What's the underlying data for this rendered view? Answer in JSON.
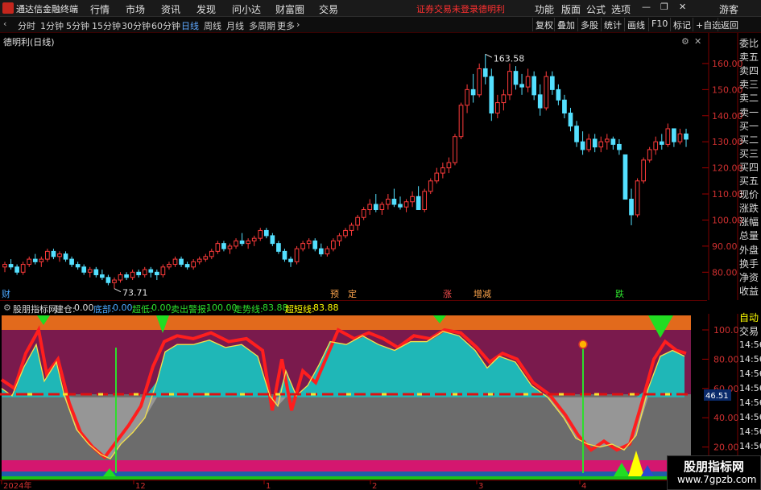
{
  "titlebar": {
    "app_title": "通达信金融终端",
    "menus": [
      "行情",
      "市场",
      "资讯",
      "发现",
      "问小达",
      "财富圈",
      "交易"
    ],
    "notice": "证券交易未登录",
    "stock": "德明利",
    "right_menus": [
      "功能",
      "版面",
      "公式",
      "选项"
    ],
    "guest": "游客"
  },
  "toolbar": {
    "periods": [
      "分时",
      "1分钟",
      "5分钟",
      "15分钟",
      "30分钟",
      "60分钟",
      "日线",
      "周线",
      "月线",
      "多周期",
      "更多"
    ],
    "active_period": "日线",
    "right_buttons": [
      "复权",
      "叠加",
      "多股",
      "统计",
      "画线",
      "F10",
      "标记",
      "+自选",
      "返回"
    ]
  },
  "main": {
    "stock_label": "德明利(日线)",
    "high_label": "163.58",
    "low_label": "73.71",
    "y_ticks": [
      "160.00",
      "150.00",
      "140.00",
      "130.00",
      "120.00",
      "110.00",
      "100.00",
      "90.00",
      "80.00"
    ],
    "x_ticks": [
      "2024年",
      "12",
      "1",
      "2",
      "3",
      "4"
    ],
    "event_tags": [
      "财",
      "预",
      "定",
      "涨",
      "增减",
      "跌"
    ]
  },
  "indicator": {
    "name": "股朋指标网",
    "fields": [
      {
        "label": "建仓:",
        "value": "0.00"
      },
      {
        "label": "底部:",
        "value": "0.00"
      },
      {
        "label": "超低:",
        "value": "0.00"
      },
      {
        "label": "卖出警报:",
        "value": "100.00"
      },
      {
        "label": "走势线:",
        "value": "83.88"
      },
      {
        "label": "超短线:",
        "value": "83.88"
      }
    ],
    "y_ticks": [
      "100.0",
      "80.00",
      "60.00",
      "40.00",
      "20.00"
    ],
    "current_value": "46.51",
    "times": [
      "14:56",
      "14:56",
      "14:56",
      "14:56",
      "14:56",
      "14:56",
      "14:56",
      "14:56"
    ]
  },
  "sidebar": {
    "items": [
      "委比",
      "卖五",
      "卖四",
      "卖三",
      "卖二",
      "卖一",
      "买一",
      "买二",
      "买三",
      "买四",
      "买五",
      "现价",
      "涨跌",
      "涨幅",
      "总量",
      "外盘",
      "换手",
      "净资",
      "收益"
    ],
    "auto": "自动",
    "trade": "交易"
  },
  "watermark": {
    "name": "股朋指标网",
    "url": "www.7gpzb.com"
  },
  "chart_data": {
    "type": "candlestick",
    "title": "德明利(日线)",
    "y_range": [
      73,
      168
    ],
    "candles": [
      [
        82,
        84,
        80,
        83
      ],
      [
        83,
        85,
        81,
        82
      ],
      [
        82,
        83,
        79,
        80
      ],
      [
        80,
        84,
        79,
        83
      ],
      [
        83,
        86,
        82,
        85
      ],
      [
        85,
        87,
        83,
        84
      ],
      [
        84,
        86,
        82,
        85
      ],
      [
        85,
        89,
        84,
        88
      ],
      [
        88,
        89,
        85,
        86
      ],
      [
        86,
        88,
        84,
        87
      ],
      [
        87,
        88,
        84,
        85
      ],
      [
        85,
        86,
        82,
        83
      ],
      [
        83,
        84,
        81,
        82
      ],
      [
        82,
        83,
        79,
        80
      ],
      [
        80,
        82,
        78,
        81
      ],
      [
        81,
        82,
        78,
        79
      ],
      [
        79,
        81,
        77,
        78
      ],
      [
        78,
        79,
        75,
        76
      ],
      [
        76,
        78,
        73.71,
        77
      ],
      [
        77,
        80,
        76,
        79
      ],
      [
        79,
        80,
        77,
        78
      ],
      [
        78,
        81,
        77,
        80
      ],
      [
        80,
        81,
        78,
        79
      ],
      [
        79,
        82,
        78,
        81
      ],
      [
        81,
        82,
        78,
        80
      ],
      [
        80,
        81,
        77,
        79
      ],
      [
        79,
        83,
        78,
        82
      ],
      [
        82,
        84,
        81,
        83
      ],
      [
        83,
        86,
        82,
        85
      ],
      [
        85,
        86,
        82,
        83
      ],
      [
        83,
        84,
        81,
        82
      ],
      [
        82,
        85,
        81,
        84
      ],
      [
        84,
        86,
        83,
        85
      ],
      [
        85,
        87,
        84,
        86
      ],
      [
        86,
        89,
        85,
        88
      ],
      [
        88,
        92,
        87,
        91
      ],
      [
        91,
        92,
        88,
        89
      ],
      [
        89,
        91,
        87,
        90
      ],
      [
        90,
        93,
        89,
        92
      ],
      [
        92,
        95,
        90,
        91
      ],
      [
        91,
        93,
        89,
        92
      ],
      [
        92,
        94,
        90,
        93
      ],
      [
        93,
        97,
        92,
        96
      ],
      [
        96,
        97,
        93,
        94
      ],
      [
        94,
        95,
        90,
        91
      ],
      [
        91,
        92,
        87,
        88
      ],
      [
        88,
        89,
        84,
        85
      ],
      [
        85,
        86,
        82,
        84
      ],
      [
        84,
        90,
        83,
        89
      ],
      [
        89,
        92,
        88,
        91
      ],
      [
        91,
        93,
        89,
        92
      ],
      [
        92,
        93,
        88,
        89
      ],
      [
        89,
        91,
        86,
        87
      ],
      [
        87,
        90,
        86,
        89
      ],
      [
        89,
        93,
        88,
        92
      ],
      [
        92,
        95,
        90,
        94
      ],
      [
        94,
        97,
        93,
        96
      ],
      [
        96,
        99,
        94,
        98
      ],
      [
        98,
        102,
        96,
        101
      ],
      [
        101,
        105,
        100,
        104
      ],
      [
        104,
        108,
        102,
        106
      ],
      [
        106,
        110,
        103,
        104
      ],
      [
        104,
        107,
        102,
        106
      ],
      [
        106,
        110,
        104,
        108
      ],
      [
        108,
        112,
        105,
        106
      ],
      [
        106,
        109,
        104,
        105
      ],
      [
        105,
        108,
        103,
        107
      ],
      [
        107,
        111,
        105,
        109
      ],
      [
        109,
        113,
        106,
        104
      ],
      [
        104,
        112,
        103,
        111
      ],
      [
        111,
        116,
        110,
        115
      ],
      [
        115,
        120,
        114,
        118
      ],
      [
        118,
        122,
        116,
        120
      ],
      [
        120,
        124,
        118,
        122
      ],
      [
        122,
        133,
        121,
        132
      ],
      [
        132,
        145,
        131,
        144
      ],
      [
        144,
        152,
        141,
        150
      ],
      [
        150,
        156,
        145,
        148
      ],
      [
        148,
        160,
        147,
        158
      ],
      [
        158,
        163.58,
        152,
        155
      ],
      [
        155,
        158,
        138,
        141
      ],
      [
        141,
        148,
        139,
        145
      ],
      [
        145,
        150,
        142,
        148
      ],
      [
        148,
        160,
        146,
        157
      ],
      [
        157,
        159,
        150,
        152
      ],
      [
        152,
        156,
        148,
        151
      ],
      [
        151,
        158,
        149,
        155
      ],
      [
        155,
        157,
        146,
        148
      ],
      [
        148,
        152,
        140,
        143
      ],
      [
        143,
        157,
        142,
        155
      ],
      [
        155,
        157,
        148,
        150
      ],
      [
        150,
        152,
        144,
        146
      ],
      [
        146,
        148,
        139,
        141
      ],
      [
        141,
        143,
        134,
        136
      ],
      [
        136,
        138,
        128,
        130
      ],
      [
        130,
        134,
        125,
        127
      ],
      [
        127,
        133,
        126,
        131
      ],
      [
        131,
        133,
        126,
        128
      ],
      [
        128,
        132,
        126,
        130
      ],
      [
        130,
        133,
        127,
        131
      ],
      [
        131,
        132,
        127,
        129
      ],
      [
        129,
        131,
        125,
        127
      ],
      [
        125,
        117,
        110,
        108
      ],
      [
        108,
        112,
        98,
        102
      ],
      [
        102,
        116,
        101,
        115
      ],
      [
        115,
        124,
        114,
        123
      ],
      [
        123,
        128,
        122,
        127
      ],
      [
        127,
        132,
        125,
        130
      ],
      [
        130,
        133,
        127,
        129
      ],
      [
        129,
        137,
        128,
        135
      ],
      [
        135,
        134,
        128,
        130
      ],
      [
        130,
        135,
        129,
        133
      ],
      [
        133,
        135,
        128,
        131
      ]
    ]
  }
}
